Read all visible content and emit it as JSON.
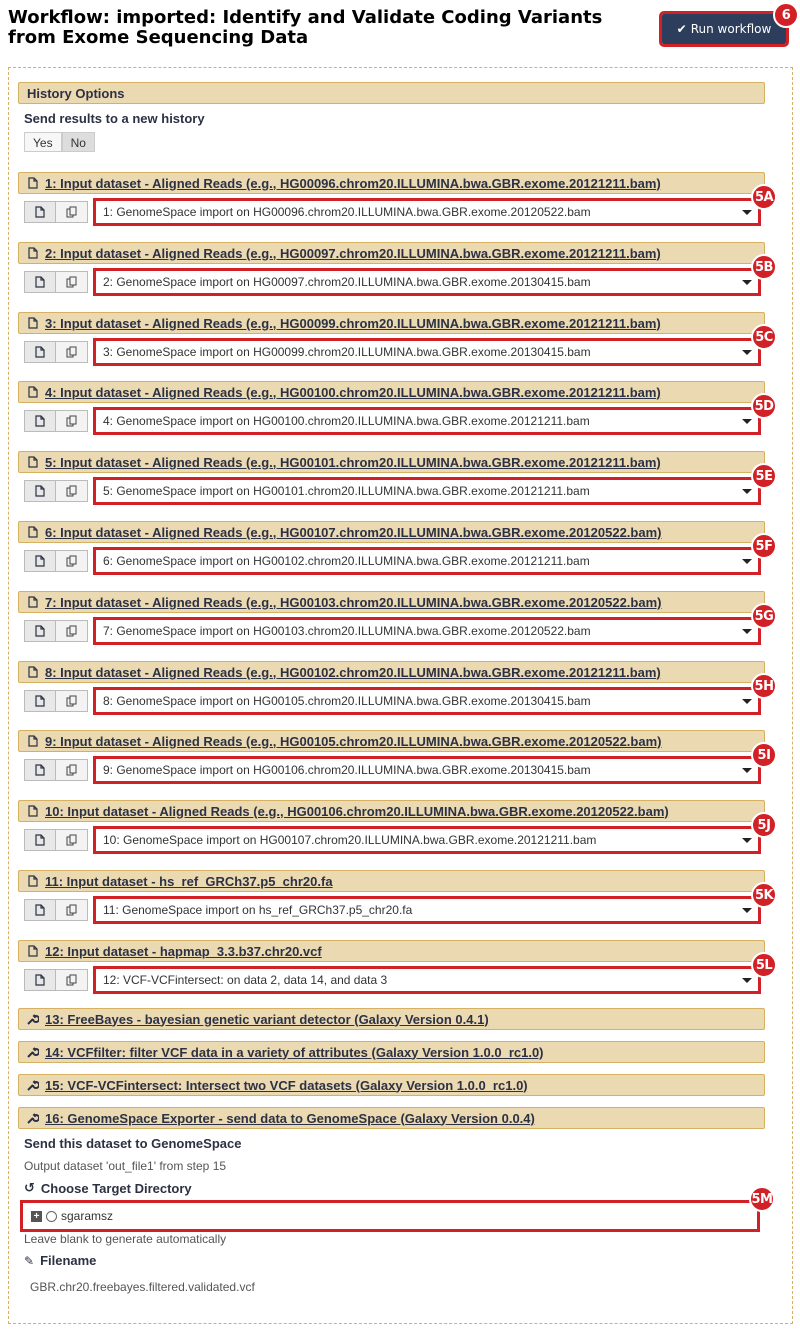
{
  "header": {
    "title_line1": "Workflow: imported: Identify and Validate Coding Variants",
    "title_line2": "from Exome Sequencing Data",
    "run_button": "Run workflow",
    "run_badge": "6"
  },
  "history": {
    "section_title": "History Options",
    "send_label": "Send results to a new history",
    "yes": "Yes",
    "no": "No"
  },
  "inputs": [
    {
      "title": "1: Input dataset - Aligned Reads (e.g., HG00096.chrom20.ILLUMINA.bwa.GBR.exome.20121211.bam)",
      "value": "1: GenomeSpace import on HG00096.chrom20.ILLUMINA.bwa.GBR.exome.20120522.bam",
      "badge": "5A"
    },
    {
      "title": "2: Input dataset - Aligned Reads (e.g., HG00097.chrom20.ILLUMINA.bwa.GBR.exome.20121211.bam)",
      "value": "2: GenomeSpace import on HG00097.chrom20.ILLUMINA.bwa.GBR.exome.20130415.bam",
      "badge": "5B"
    },
    {
      "title": "3: Input dataset - Aligned Reads (e.g., HG00099.chrom20.ILLUMINA.bwa.GBR.exome.20121211.bam)",
      "value": "3: GenomeSpace import on HG00099.chrom20.ILLUMINA.bwa.GBR.exome.20130415.bam",
      "badge": "5C"
    },
    {
      "title": "4: Input dataset - Aligned Reads (e.g., HG00100.chrom20.ILLUMINA.bwa.GBR.exome.20121211.bam)",
      "value": "4: GenomeSpace import on HG00100.chrom20.ILLUMINA.bwa.GBR.exome.20121211.bam",
      "badge": "5D"
    },
    {
      "title": "5: Input dataset - Aligned Reads (e.g., HG00101.chrom20.ILLUMINA.bwa.GBR.exome.20121211.bam)",
      "value": "5: GenomeSpace import on HG00101.chrom20.ILLUMINA.bwa.GBR.exome.20121211.bam",
      "badge": "5E"
    },
    {
      "title": "6: Input dataset - Aligned Reads (e.g., HG00107.chrom20.ILLUMINA.bwa.GBR.exome.20120522.bam)",
      "value": "6: GenomeSpace import on HG00102.chrom20.ILLUMINA.bwa.GBR.exome.20121211.bam",
      "badge": "5F"
    },
    {
      "title": "7: Input dataset - Aligned Reads (e.g., HG00103.chrom20.ILLUMINA.bwa.GBR.exome.20120522.bam)",
      "value": "7: GenomeSpace import on HG00103.chrom20.ILLUMINA.bwa.GBR.exome.20120522.bam",
      "badge": "5G"
    },
    {
      "title": "8: Input dataset - Aligned Reads (e.g., HG00102.chrom20.ILLUMINA.bwa.GBR.exome.20121211.bam)",
      "value": "8: GenomeSpace import on HG00105.chrom20.ILLUMINA.bwa.GBR.exome.20130415.bam",
      "badge": "5H"
    },
    {
      "title": "9: Input dataset - Aligned Reads (e.g., HG00105.chrom20.ILLUMINA.bwa.GBR.exome.20120522.bam)",
      "value": "9: GenomeSpace import on HG00106.chrom20.ILLUMINA.bwa.GBR.exome.20130415.bam",
      "badge": "5I"
    },
    {
      "title": "10: Input dataset - Aligned Reads (e.g., HG00106.chrom20.ILLUMINA.bwa.GBR.exome.20120522.bam)",
      "value": "10: GenomeSpace import on HG00107.chrom20.ILLUMINA.bwa.GBR.exome.20121211.bam",
      "badge": "5J"
    },
    {
      "title": "11: Input dataset - hs_ref_GRCh37.p5_chr20.fa",
      "value": "11: GenomeSpace import on hs_ref_GRCh37.p5_chr20.fa",
      "badge": "5K"
    },
    {
      "title": "12: Input dataset - hapmap_3.3.b37.chr20.vcf",
      "value": "12: VCF-VCFintersect: on data 2, data 14, and data 3",
      "badge": "5L"
    }
  ],
  "tools": [
    "13: FreeBayes - bayesian genetic variant detector (Galaxy Version 0.4.1)",
    "14: VCFfilter: filter VCF data in a variety of attributes (Galaxy Version 1.0.0_rc1.0)",
    "15: VCF-VCFintersect: Intersect two VCF datasets (Galaxy Version 1.0.0_rc1.0)",
    "16: GenomeSpace Exporter - send data to GenomeSpace (Galaxy Version 0.0.4)"
  ],
  "exporter": {
    "send_label": "Send this dataset to GenomeSpace",
    "output_text": "Output dataset 'out_file1' from step 15",
    "target_label": "Choose Target Directory",
    "tree_item": "sgaramsz",
    "tree_badge": "5M",
    "hint": "Leave blank to generate automatically",
    "filename_label": "Filename",
    "filename_value": "GBR.chr20.freebayes.filtered.validated.vcf"
  },
  "colors": {
    "accent": "#d22027",
    "section_bg": "#ebd9b2",
    "button_bg": "#2c3e5b"
  }
}
